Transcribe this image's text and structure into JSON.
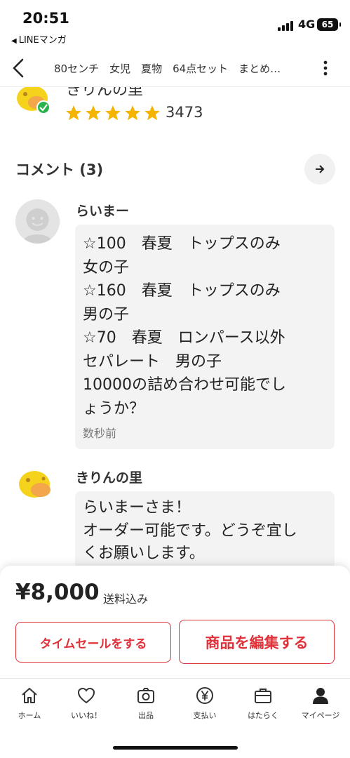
{
  "status_bar": {
    "time": "20:51",
    "back_app": "LINEマンガ",
    "network": "4G",
    "battery": "65"
  },
  "nav": {
    "title": "80センチ　女児　夏物　64点セット　まとめ…"
  },
  "seller": {
    "name": "きりんの里",
    "stars": 5,
    "rating_count": "3473"
  },
  "comments": {
    "heading": "コメント (3)",
    "items": [
      {
        "author": "らいまー",
        "text": "☆100　春夏　トップスのみ\n女の子\n☆160　春夏　トップスのみ\n男の子\n☆70　春夏　ロンパース以外\nセパレート　男の子\n10000の詰め合わせ可能でし\nょうか？",
        "time": "数秒前"
      },
      {
        "author": "きりんの里",
        "text": "らいまーさま！\nオーダー可能です。どうぞ宜し\nくお願いします。"
      }
    ]
  },
  "purchase": {
    "price": "¥8,000",
    "price_note": "送料込み",
    "timesale_label": "タイムセールをする",
    "edit_label": "商品を編集する",
    "accent_color": "#e0323a"
  },
  "tab_bar": [
    {
      "label": "ホーム",
      "icon": "home-icon"
    },
    {
      "label": "いいね！",
      "icon": "heart-icon"
    },
    {
      "label": "出品",
      "icon": "camera-icon"
    },
    {
      "label": "支払い",
      "icon": "yen-icon"
    },
    {
      "label": "はたらく",
      "icon": "briefcase-icon"
    },
    {
      "label": "マイページ",
      "icon": "person-icon"
    }
  ]
}
